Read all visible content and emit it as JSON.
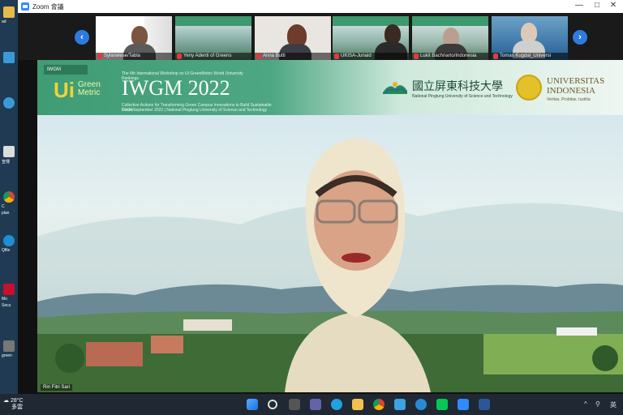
{
  "window": {
    "title": "Zoom 會議"
  },
  "desktop": {
    "labels": [
      "ad",
      "",
      "",
      "",
      "宣傳",
      "C",
      "plan",
      "Q",
      "Qfile",
      "M",
      "Mo",
      "Secu",
      "",
      "green"
    ]
  },
  "participants": [
    {
      "name": "Sylarwiese/Tabla"
    },
    {
      "name": "Yeny Adenti of Greens"
    },
    {
      "name": "Anna Butti"
    },
    {
      "name": "UKISA-Junaid"
    },
    {
      "name": "Lukit Bachriarto/Indonesia"
    },
    {
      "name": "Tomas Kugdal_Universi"
    }
  ],
  "banner": {
    "tag": "IWGM",
    "logo_text": "Ui",
    "logo_sub": "Green Metric",
    "subtitle": "The 6th International Workshop on UI GreenMetric World University Rankings",
    "title": "IWGM 2022",
    "subtitle2": "Collective Actions for Transforming Green Campus Innovations to Build Sustainable Future",
    "dates": "21-24 September 2022 | National Pingtung University of Science and Technology",
    "npust_cn": "國立屏東科技大學",
    "npust_en": "National Pingtung University of Science and Technology",
    "univ": "UNIVERSITAS INDONESIA",
    "univ_sub": "Veritas, Probitas, Iustitia"
  },
  "main_video": {
    "name": "Riri Fitri Sari"
  },
  "taskbar": {
    "temp": "28°C",
    "weather": "多雲",
    "tray_lang": "英"
  }
}
